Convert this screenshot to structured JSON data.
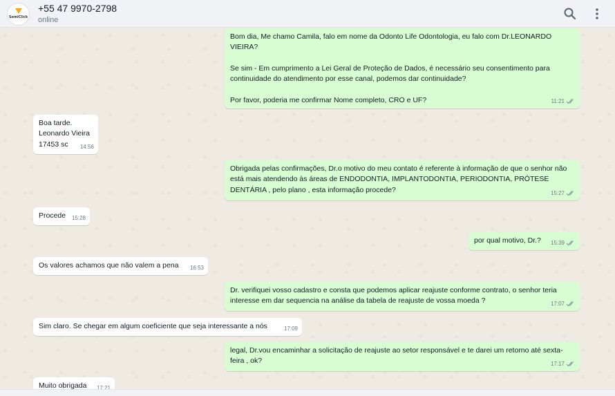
{
  "header": {
    "avatar_label": "SemiClick",
    "contact": "+55 47 9970-2798",
    "status": "online",
    "search_icon": "search-icon",
    "menu_icon": "kebab-menu-icon"
  },
  "colors": {
    "outgoing_bubble": "#d9fdd3",
    "incoming_bubble": "#ffffff",
    "chat_background": "#efeae2",
    "header_background": "#f0f2f5",
    "read_ticks": "#8696a0"
  },
  "messages": [
    {
      "direction": "out",
      "text": "Bom dia, Me chamo Camila, falo em nome da Odonto Life Odontologia, eu falo com Dr.LEONARDO VIEIRA?\n\nSe sim - Em cumprimento a Lei Geral de Proteção de Dados, é necessário seu consentimento para continuidade do atendimento por esse canal, podemos dar continuidade?\n\nPor favor, poderia me confirmar Nome completo, CRO e UF?",
      "time": "11:21"
    },
    {
      "direction": "in",
      "text": "Boa tarde.\nLeonardo Vieira\n17453 sc",
      "time": "14:56"
    },
    {
      "direction": "out",
      "text": "Obrigada pelas confirmações, Dr.o motivo do meu contato é referente à informação de que o senhor não está mais atendendo às áreas de ENDODONTIA, IMPLANTODONTIA, PERIODONTIA, PRÓTESE DENTÁRIA , pelo plano , esta informação procede?",
      "time": "15:27"
    },
    {
      "direction": "in",
      "text": "Procede",
      "time": "15:28"
    },
    {
      "direction": "out",
      "text": "por qual motivo, Dr.?",
      "time": "15:39"
    },
    {
      "direction": "in",
      "text": "Os valores achamos que não valem a pena",
      "time": "16:53"
    },
    {
      "direction": "out",
      "text": "Dr. verifiquei vosso cadastro e consta que podemos aplicar reajuste conforme contrato, o senhor teria interesse em dar sequencia na análise da tabela de reajuste de vossa moeda ?",
      "time": "17:07"
    },
    {
      "direction": "in",
      "text": "Sim claro. Se chegar em algum coeficiente que seja interessante a nós",
      "time": "17:09"
    },
    {
      "direction": "out",
      "text": "legal, Dr.vou encaminhar a solicitação de reajuste ao setor responsável e te darei um retorno até sexta-feira , ok?",
      "time": "17:17"
    },
    {
      "direction": "in",
      "text": "Muito obrigada",
      "time": "17:21"
    }
  ]
}
